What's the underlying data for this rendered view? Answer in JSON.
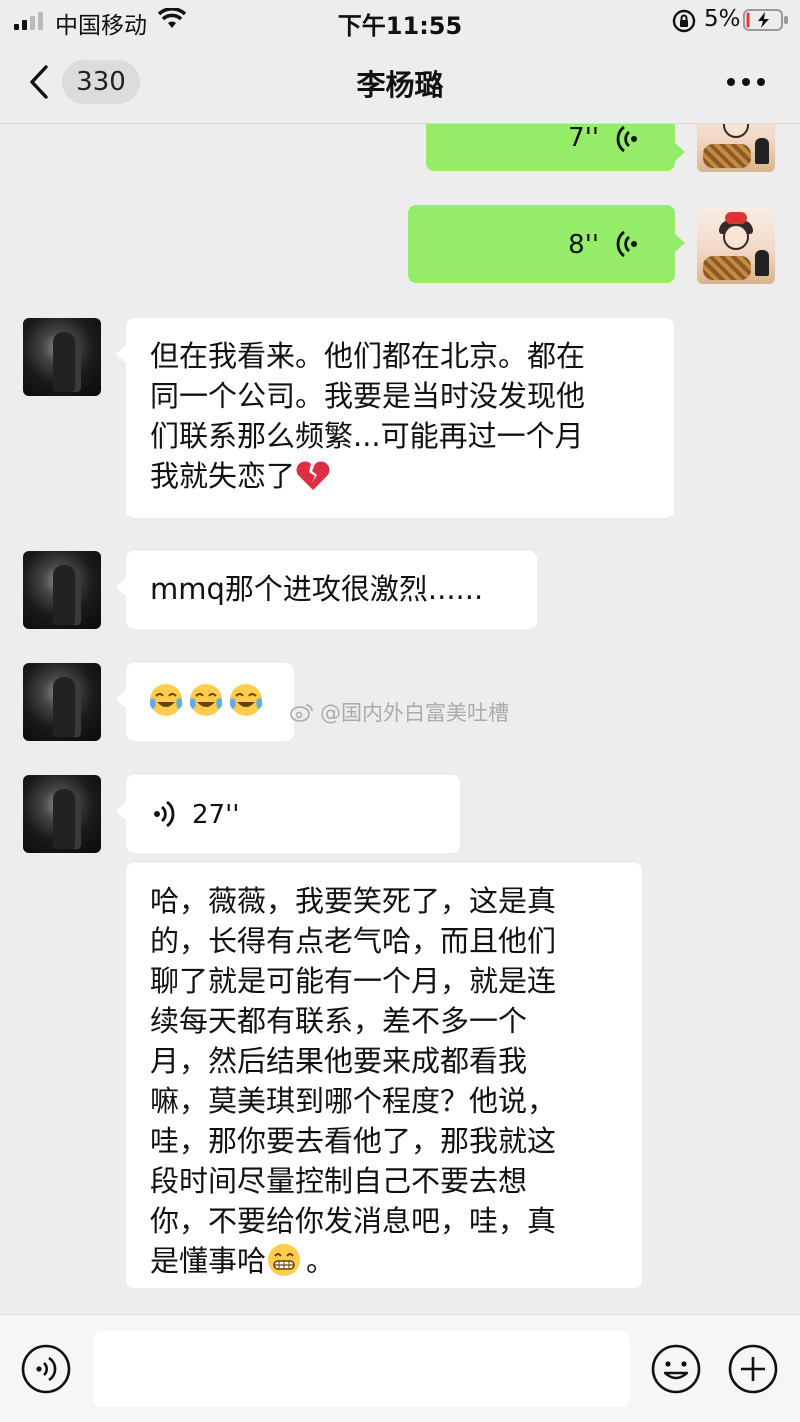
{
  "status_bar": {
    "carrier": "中国移动",
    "time": "下午11:55",
    "battery_percent": "5%",
    "icons": [
      "signal-icon",
      "wifi-icon",
      "orientation-lock-icon",
      "battery-charging-icon"
    ]
  },
  "header": {
    "back_icon": "chevron-left-icon",
    "unread_count": "330",
    "title": "李杨璐",
    "more_icon": "more-dots-icon"
  },
  "messages": [
    {
      "id": 1,
      "side": "right",
      "type": "voice",
      "duration": "7''"
    },
    {
      "id": 2,
      "side": "right",
      "type": "voice",
      "duration": "8''"
    },
    {
      "id": 3,
      "side": "left",
      "type": "text",
      "lines": [
        "但在我看来。他们都在北京。都在",
        "同一个公司。我要是当时没发现他",
        "们联系那么频繁...可能再过一个月",
        "我就失恋了"
      ],
      "trailing_emoji": "broken-heart-icon"
    },
    {
      "id": 4,
      "side": "left",
      "type": "text",
      "lines": [
        "mmq那个进攻很激烈......"
      ]
    },
    {
      "id": 5,
      "side": "left",
      "type": "emoji",
      "emojis": [
        "crying-laughing-icon",
        "crying-laughing-icon",
        "crying-laughing-icon"
      ]
    },
    {
      "id": 6,
      "side": "left",
      "type": "voice",
      "duration": "27''",
      "transcript_lines": [
        "哈，薇薇，我要笑死了，这是真",
        "的，长得有点老气哈，而且他们",
        "聊了就是可能有一个月，就是连",
        "续每天都有联系，差不多一个",
        "月，然后结果他要来成都看我",
        "嘛，莫美琪到哪个程度？他说，",
        "哇，那你要去看他了，那我就这",
        "段时间尽量控制自己不要去想",
        "你，不要给你发消息吧，哇，真",
        "是懂事哈"
      ],
      "transcript_trailing": "。",
      "transcript_emoji": "grinning-face-icon"
    }
  ],
  "watermark": {
    "text": "@国内外白富美吐槽",
    "icon": "weibo-icon"
  },
  "bottom_bar": {
    "voice_icon": "voice-input-icon",
    "input_placeholder": "",
    "emoji_icon": "emoji-icon",
    "plus_icon": "add-icon"
  },
  "colors": {
    "background": "#ededed",
    "sent_bubble": "#95ec69",
    "received_bubble": "#ffffff"
  }
}
